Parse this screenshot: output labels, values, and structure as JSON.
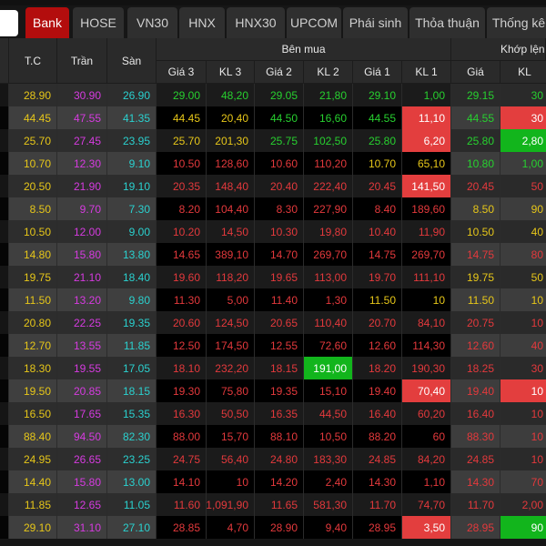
{
  "tabs": [
    "Bank",
    "HOSE",
    "VN30",
    "HNX",
    "HNX30",
    "UPCOM",
    "Phái sinh",
    "Thỏa thuận",
    "Thống kê"
  ],
  "header": {
    "tc": "T.C",
    "tran": "Trần",
    "san": "Sàn",
    "ben_mua": "Bên mua",
    "khop_lenh": "Khớp lệnh",
    "sub": [
      "Giá 3",
      "KL 3",
      "Giá 2",
      "KL 2",
      "Giá 1",
      "KL 1",
      "Giá",
      "KL"
    ]
  },
  "colors": {
    "y": "#e6c619",
    "g": "#27d02f",
    "r": "#e3393c",
    "ceiling": "#d63be0",
    "floor": "#2ad1cf",
    "highlight_red": "#e33e3e",
    "highlight_green": "#12b51c"
  },
  "rows": [
    {
      "ref": "28.90",
      "ceil": "30.90",
      "floor": "26.90",
      "cells": [
        [
          "29.00",
          "48,20",
          "g"
        ],
        [
          "29.05",
          "21,80",
          "g"
        ],
        [
          "29.10",
          "1,00",
          "g"
        ],
        [
          "29.15",
          "30",
          "g"
        ]
      ]
    },
    {
      "ref": "44.45",
      "ceil": "47.55",
      "floor": "41.35",
      "cells": [
        [
          "44.45",
          "20,40",
          "y"
        ],
        [
          "44.50",
          "16,60",
          "g"
        ],
        [
          "44.55",
          "11,10",
          "g",
          "",
          "hlr"
        ],
        [
          "44.55",
          "30",
          "g",
          "",
          "hlr"
        ]
      ]
    },
    {
      "ref": "25.70",
      "ceil": "27.45",
      "floor": "23.95",
      "cells": [
        [
          "25.70",
          "201,30",
          "y"
        ],
        [
          "25.75",
          "102,50",
          "g"
        ],
        [
          "25.80",
          "6,20",
          "g",
          "",
          "hlr"
        ],
        [
          "25.80",
          "2,80",
          "g",
          "",
          "hlg"
        ]
      ]
    },
    {
      "ref": "10.70",
      "ceil": "12.30",
      "floor": "9.10",
      "cells": [
        [
          "10.50",
          "128,60",
          "r"
        ],
        [
          "10.60",
          "110,20",
          "r"
        ],
        [
          "10.70",
          "65,10",
          "y"
        ],
        [
          "10.80",
          "1,00",
          "g"
        ]
      ]
    },
    {
      "ref": "20.50",
      "ceil": "21.90",
      "floor": "19.10",
      "cells": [
        [
          "20.35",
          "148,40",
          "r"
        ],
        [
          "20.40",
          "222,40",
          "r"
        ],
        [
          "20.45",
          "141,50",
          "r",
          "",
          "hlr"
        ],
        [
          "20.45",
          "50",
          "r"
        ]
      ]
    },
    {
      "ref": "8.50",
      "ceil": "9.70",
      "floor": "7.30",
      "cells": [
        [
          "8.20",
          "104,40",
          "r"
        ],
        [
          "8.30",
          "227,90",
          "r"
        ],
        [
          "8.40",
          "189,60",
          "r"
        ],
        [
          "8.50",
          "90",
          "y"
        ]
      ]
    },
    {
      "ref": "10.50",
      "ceil": "12.00",
      "floor": "9.00",
      "cells": [
        [
          "10.20",
          "14,50",
          "r"
        ],
        [
          "10.30",
          "19,80",
          "r"
        ],
        [
          "10.40",
          "11,90",
          "r"
        ],
        [
          "10.50",
          "40",
          "y"
        ]
      ]
    },
    {
      "ref": "14.80",
      "ceil": "15.80",
      "floor": "13.80",
      "cells": [
        [
          "14.65",
          "389,10",
          "r"
        ],
        [
          "14.70",
          "269,70",
          "r"
        ],
        [
          "14.75",
          "269,70",
          "r"
        ],
        [
          "14.75",
          "80",
          "r"
        ]
      ]
    },
    {
      "ref": "19.75",
      "ceil": "21.10",
      "floor": "18.40",
      "cells": [
        [
          "19.60",
          "118,20",
          "r"
        ],
        [
          "19.65",
          "113,00",
          "r"
        ],
        [
          "19.70",
          "111,10",
          "r"
        ],
        [
          "19.75",
          "50",
          "y"
        ]
      ]
    },
    {
      "ref": "11.50",
      "ceil": "13.20",
      "floor": "9.80",
      "cells": [
        [
          "11.30",
          "5,00",
          "r"
        ],
        [
          "11.40",
          "1,30",
          "r"
        ],
        [
          "11.50",
          "10",
          "y"
        ],
        [
          "11.50",
          "10",
          "y"
        ]
      ]
    },
    {
      "ref": "20.80",
      "ceil": "22.25",
      "floor": "19.35",
      "cells": [
        [
          "20.60",
          "124,50",
          "r"
        ],
        [
          "20.65",
          "110,40",
          "r"
        ],
        [
          "20.70",
          "84,10",
          "r"
        ],
        [
          "20.75",
          "10",
          "r"
        ]
      ]
    },
    {
      "ref": "12.70",
      "ceil": "13.55",
      "floor": "11.85",
      "cells": [
        [
          "12.50",
          "174,50",
          "r"
        ],
        [
          "12.55",
          "72,60",
          "r"
        ],
        [
          "12.60",
          "114,30",
          "r"
        ],
        [
          "12.60",
          "40",
          "r"
        ]
      ]
    },
    {
      "ref": "18.30",
      "ceil": "19.55",
      "floor": "17.05",
      "cells": [
        [
          "18.10",
          "232,20",
          "r"
        ],
        [
          "18.15",
          "191,00",
          "r",
          "",
          "hlg"
        ],
        [
          "18.20",
          "190,30",
          "r"
        ],
        [
          "18.25",
          "30",
          "r"
        ]
      ]
    },
    {
      "ref": "19.50",
      "ceil": "20.85",
      "floor": "18.15",
      "cells": [
        [
          "19.30",
          "75,80",
          "r"
        ],
        [
          "19.35",
          "15,10",
          "r"
        ],
        [
          "19.40",
          "70,40",
          "r",
          "",
          "hlr"
        ],
        [
          "19.40",
          "10",
          "r",
          "",
          "hlr"
        ]
      ]
    },
    {
      "ref": "16.50",
      "ceil": "17.65",
      "floor": "15.35",
      "cells": [
        [
          "16.30",
          "50,50",
          "r"
        ],
        [
          "16.35",
          "44,50",
          "r"
        ],
        [
          "16.40",
          "60,20",
          "r"
        ],
        [
          "16.40",
          "10",
          "r"
        ]
      ]
    },
    {
      "ref": "88.40",
      "ceil": "94.50",
      "floor": "82.30",
      "cells": [
        [
          "88.00",
          "15,70",
          "r"
        ],
        [
          "88.10",
          "10,50",
          "r"
        ],
        [
          "88.20",
          "60",
          "r"
        ],
        [
          "88.30",
          "10",
          "r"
        ]
      ]
    },
    {
      "ref": "24.95",
      "ceil": "26.65",
      "floor": "23.25",
      "cells": [
        [
          "24.75",
          "56,40",
          "r"
        ],
        [
          "24.80",
          "183,30",
          "r"
        ],
        [
          "24.85",
          "84,20",
          "r"
        ],
        [
          "24.85",
          "10",
          "r"
        ]
      ]
    },
    {
      "ref": "14.40",
      "ceil": "15.80",
      "floor": "13.00",
      "cells": [
        [
          "14.10",
          "10",
          "r"
        ],
        [
          "14.20",
          "2,40",
          "r"
        ],
        [
          "14.30",
          "1,10",
          "r"
        ],
        [
          "14.30",
          "70",
          "r"
        ]
      ]
    },
    {
      "ref": "11.85",
      "ceil": "12.65",
      "floor": "11.05",
      "cells": [
        [
          "11.60",
          "1,091,90",
          "r"
        ],
        [
          "11.65",
          "581,30",
          "r"
        ],
        [
          "11.70",
          "74,70",
          "r"
        ],
        [
          "11.70",
          "2,00",
          "r"
        ]
      ]
    },
    {
      "ref": "29.10",
      "ceil": "31.10",
      "floor": "27.10",
      "cells": [
        [
          "28.85",
          "4,70",
          "r"
        ],
        [
          "28.90",
          "9,40",
          "r"
        ],
        [
          "28.95",
          "3,50",
          "r",
          "",
          "hlr"
        ],
        [
          "28.95",
          "90",
          "r",
          "",
          "hlg"
        ]
      ]
    }
  ]
}
